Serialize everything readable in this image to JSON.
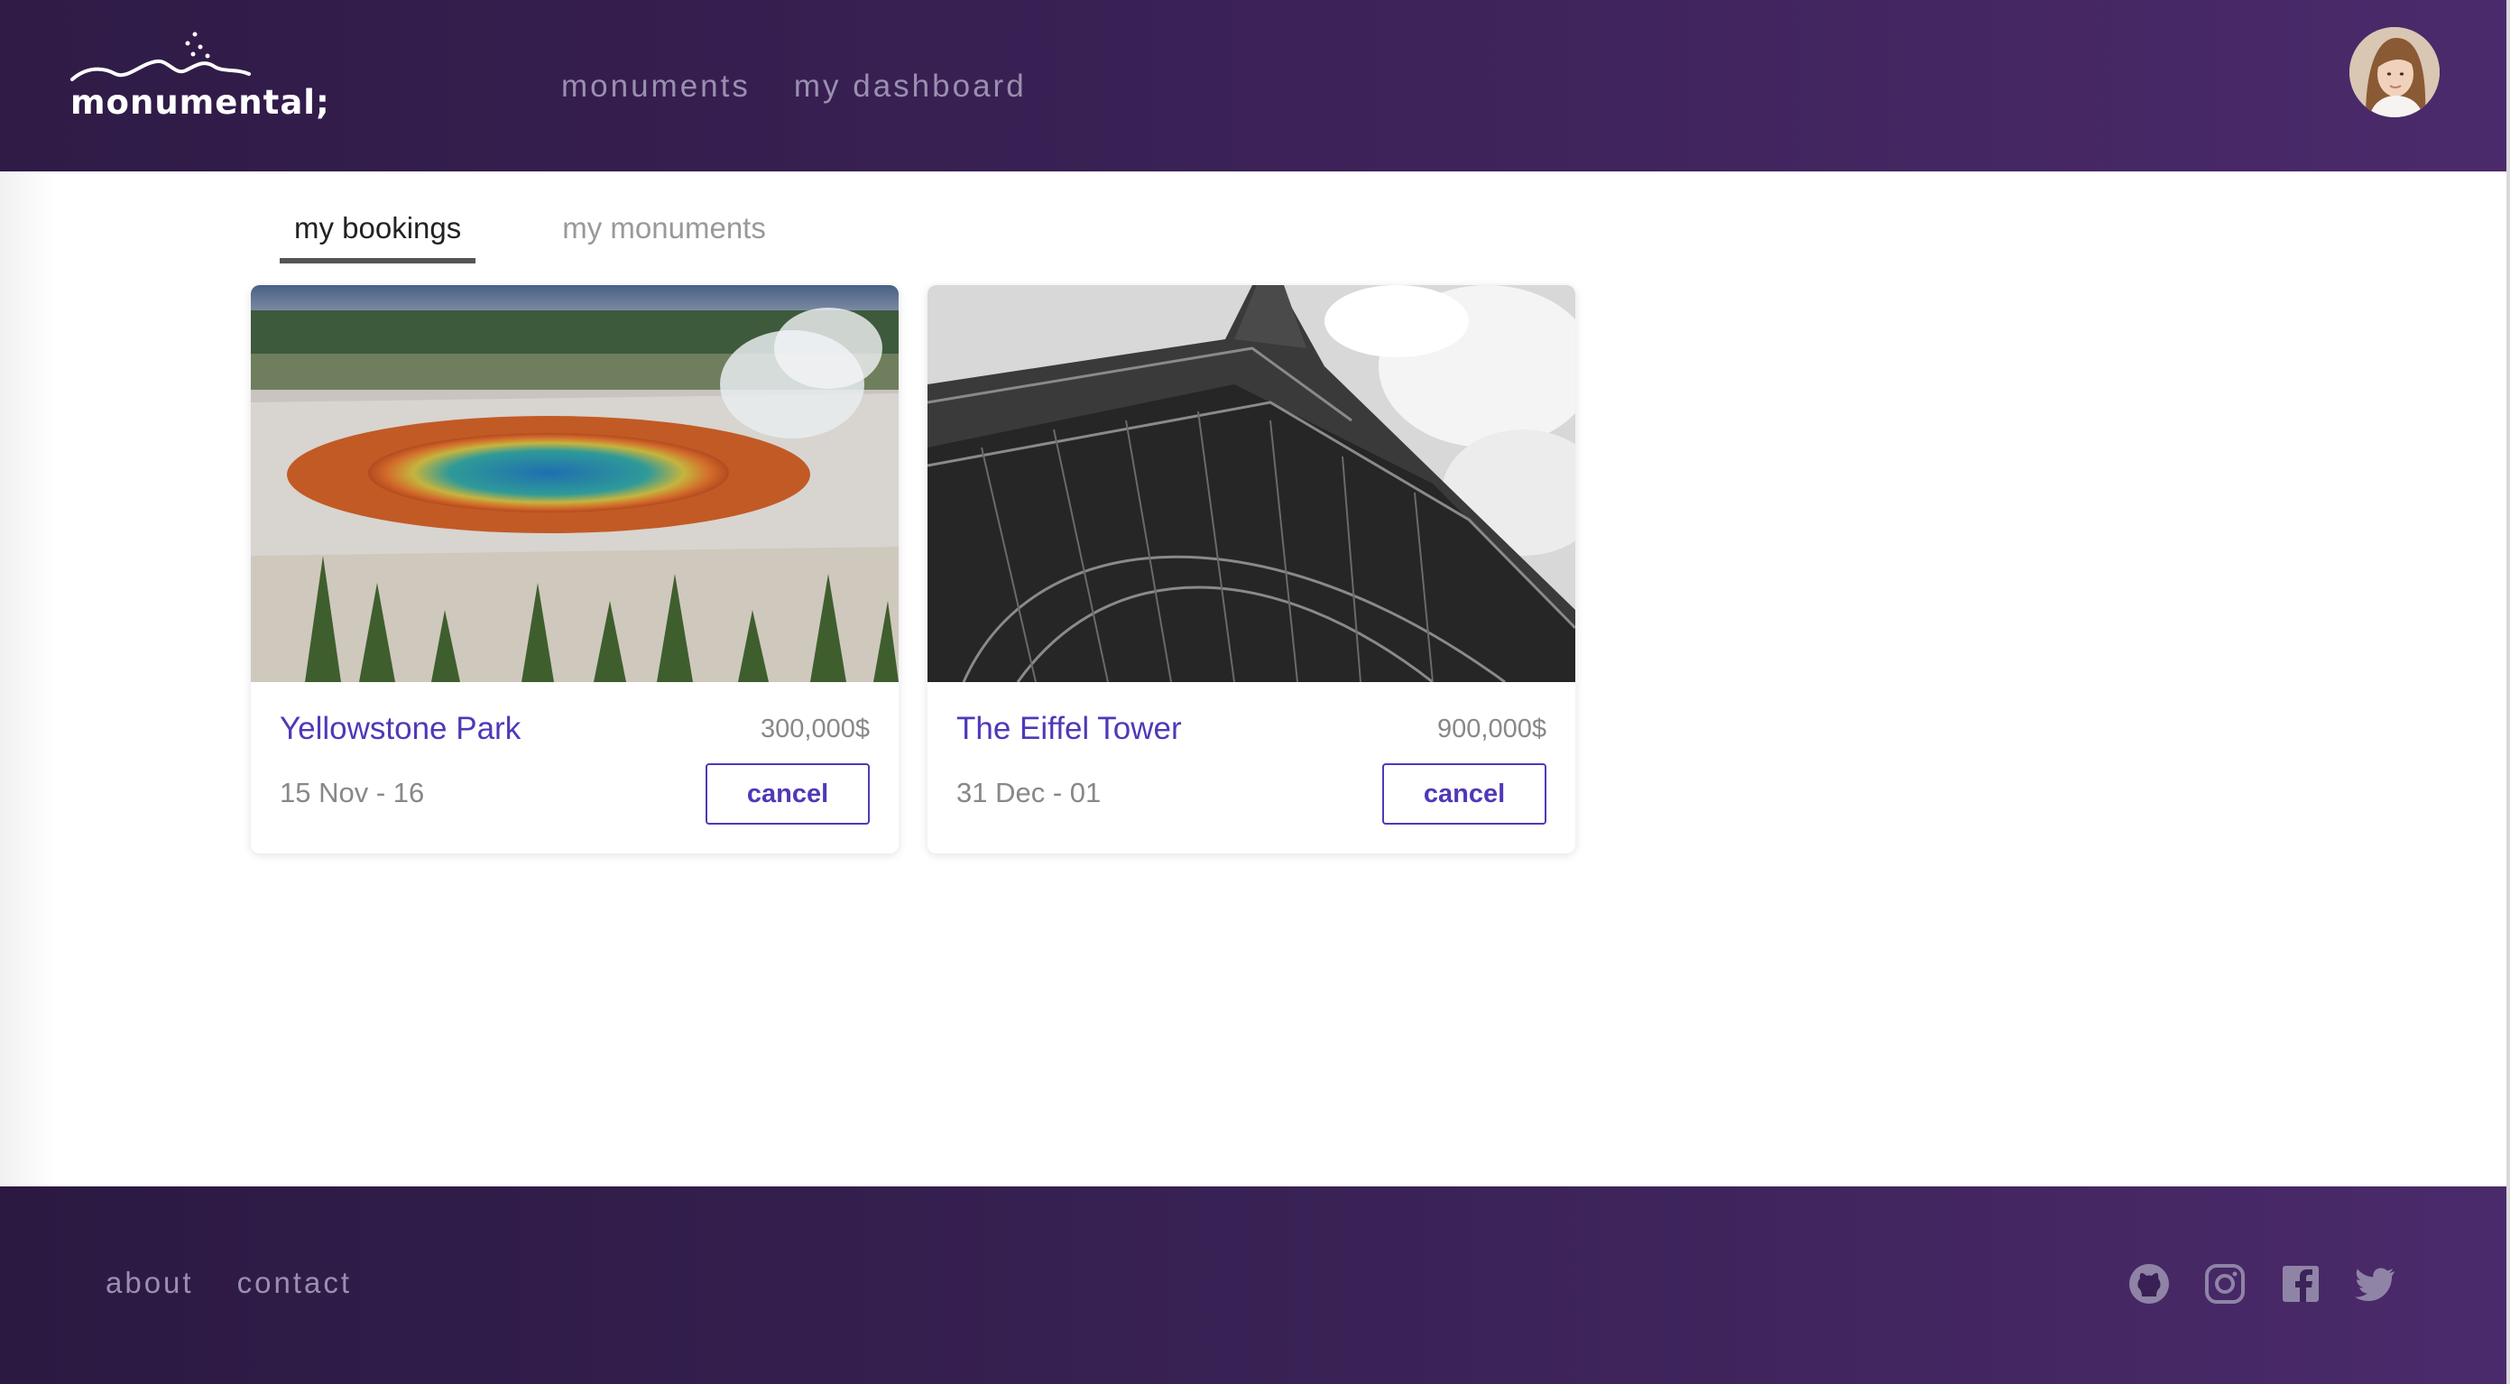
{
  "header": {
    "logo_text": "monumental;",
    "nav": [
      "monuments",
      "my dashboard"
    ]
  },
  "tabs": [
    {
      "label": "my bookings",
      "active": true
    },
    {
      "label": "my monuments",
      "active": false
    }
  ],
  "bookings": [
    {
      "title": "Yellowstone Park",
      "price": "300,000$",
      "dates": "15 Nov - 16",
      "action": "cancel"
    },
    {
      "title": "The Eiffel Tower",
      "price": "900,000$",
      "dates": "31 Dec - 01",
      "action": "cancel"
    }
  ],
  "footer": {
    "links": [
      "about",
      "contact"
    ],
    "social_icons": [
      "github-icon",
      "instagram-icon",
      "facebook-icon",
      "twitter-icon"
    ]
  },
  "colors": {
    "header_bg": "#3a2155",
    "accent": "#5038b8",
    "muted_nav": "#9a8fb0"
  }
}
